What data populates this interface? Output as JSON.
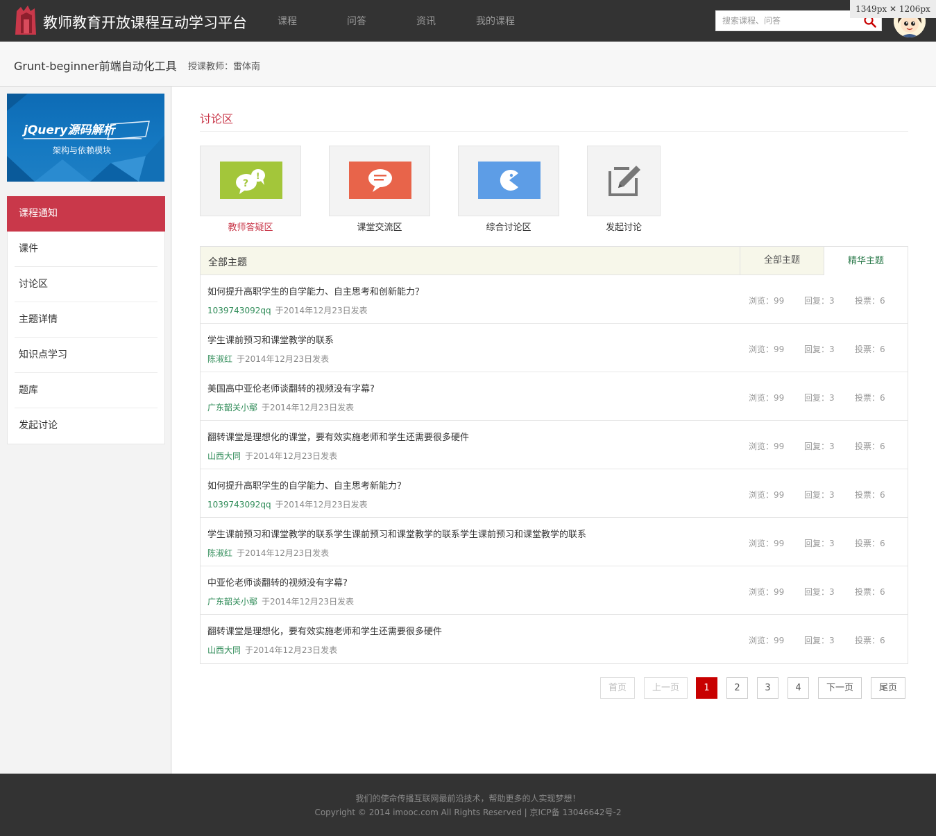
{
  "header": {
    "site_title": "教师教育开放课程互动学习平台",
    "nav": [
      "课程",
      "问答",
      "资讯",
      "我的课程"
    ],
    "search_placeholder": "搜索课程、问答",
    "dimension_badge": "1349px  ✕  1206px"
  },
  "course": {
    "title": "Grunt-beginner前端自动化工具",
    "teacher": "授课教师：雷体南"
  },
  "sidebar": {
    "banner_title": "jQuery源码解析",
    "banner_subtitle": "架构与依赖模块",
    "items": [
      {
        "label": "课程通知",
        "active": true
      },
      {
        "label": "课件",
        "active": false
      },
      {
        "label": "讨论区",
        "active": false
      },
      {
        "label": "主题详情",
        "active": false
      },
      {
        "label": "知识点学习",
        "active": false
      },
      {
        "label": "题库",
        "active": false
      },
      {
        "label": "发起讨论",
        "active": false
      }
    ]
  },
  "main": {
    "section_title": "讨论区",
    "categories": [
      {
        "label": "教师答疑区",
        "icon": "qa-bubbles-icon",
        "color": "#a3c63a",
        "highlight": true
      },
      {
        "label": "课堂交流区",
        "icon": "chat-bubble-icon",
        "color": "#e8644a",
        "highlight": false
      },
      {
        "label": "综合讨论区",
        "icon": "pacman-icon",
        "color": "#5d9de6",
        "highlight": false
      },
      {
        "label": "发起讨论",
        "icon": "edit-icon",
        "color": "#777777",
        "highlight": false
      }
    ],
    "table": {
      "header": "全部主题",
      "tabs": [
        "全部主题",
        "精华主题"
      ],
      "rows": [
        {
          "title": "如何提升高职学生的自学能力、自主思考和创新能力？",
          "author": "1039743092qq",
          "date": "于2014年12月23日发表",
          "views": "浏览：99",
          "replies": "回复：3",
          "votes": "投票：6"
        },
        {
          "title": "学生课前预习和课堂教学的联系",
          "author": "陈淑红",
          "date": "于2014年12月23日发表",
          "views": "浏览：99",
          "replies": "回复：3",
          "votes": "投票：6"
        },
        {
          "title": "美国高中亚伦老师谈翻转的视频没有字幕?",
          "author": "广东韶关小鄢",
          "date": "于2014年12月23日发表",
          "views": "浏览：99",
          "replies": "回复：3",
          "votes": "投票：6"
        },
        {
          "title": "翻转课堂是理想化的课堂，要有效实施老师和学生还需要很多硬件",
          "author": "山西大同",
          "date": "于2014年12月23日发表",
          "views": "浏览：99",
          "replies": "回复：3",
          "votes": "投票：6"
        },
        {
          "title": "如何提升高职学生的自学能力、自主思考新能力？",
          "author": "1039743092qq",
          "date": "于2014年12月23日发表",
          "views": "浏览：99",
          "replies": "回复：3",
          "votes": "投票：6"
        },
        {
          "title": "学生课前预习和课堂教学的联系学生课前预习和课堂教学的联系学生课前预习和课堂教学的联系",
          "author": "陈淑红",
          "date": "于2014年12月23日发表",
          "views": "浏览：99",
          "replies": "回复：3",
          "votes": "投票：6"
        },
        {
          "title": "中亚伦老师谈翻转的视频没有字幕?",
          "author": "广东韶关小鄢",
          "date": "于2014年12月23日发表",
          "views": "浏览：99",
          "replies": "回复：3",
          "votes": "投票：6"
        },
        {
          "title": "翻转课堂是理想化，要有效实施老师和学生还需要很多硬件",
          "author": "山西大同",
          "date": "于2014年12月23日发表",
          "views": "浏览：99",
          "replies": "回复：3",
          "votes": "投票：6"
        }
      ]
    },
    "pagination": {
      "first": "首页",
      "prev": "上一页",
      "pages": [
        "1",
        "2",
        "3",
        "4"
      ],
      "current": "1",
      "next": "下一页",
      "last": "尾页"
    }
  },
  "footer": {
    "slogan": "我们的使命传播互联网最前沿技术，帮助更多的人实现梦想！",
    "copyright": "Copyright © 2014 imooc.com All Rights Reserved | 京ICP备 13046642号-2"
  },
  "colors": {
    "topbar": "#333333",
    "accent_red": "#c9384a",
    "author_green": "#2e8b57",
    "pager_current": "#c80000"
  }
}
